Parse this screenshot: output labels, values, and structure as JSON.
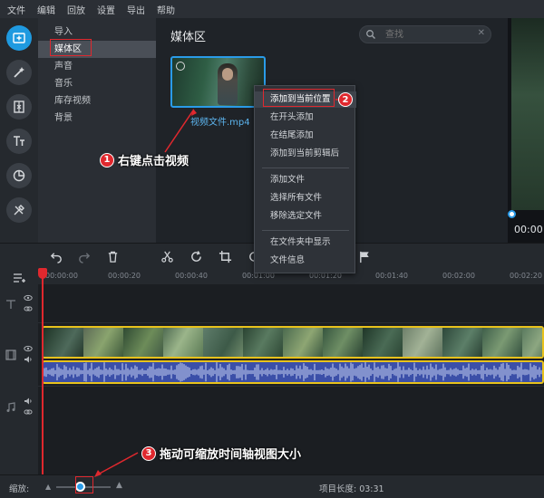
{
  "menu": [
    "文件",
    "编辑",
    "回放",
    "设置",
    "导出",
    "帮助"
  ],
  "sidebar": {
    "tools": [
      "add-media-icon",
      "magic-wand-icon",
      "transition-icon",
      "titles-icon",
      "stickers-icon",
      "tools-icon"
    ],
    "categories": [
      "导入",
      "媒体区",
      "声音",
      "音乐",
      "库存视频",
      "背景"
    ],
    "selected": "媒体区"
  },
  "media": {
    "title": "媒体区",
    "search_placeholder": "查找",
    "clip_name": "视频文件.mp4"
  },
  "context_menu": {
    "group1": [
      "添加到当前位置",
      "在开头添加",
      "在结尾添加",
      "添加到当前剪辑后"
    ],
    "group2": [
      "添加文件",
      "选择所有文件",
      "移除选定文件"
    ],
    "group3": [
      "在文件夹中显示",
      "文件信息"
    ],
    "highlighted": "添加到当前位置"
  },
  "preview": {
    "time": "00:00"
  },
  "ruler": [
    "00:00:00",
    "00:00:20",
    "00:00:40",
    "00:01:00",
    "00:01:20",
    "00:01:40",
    "00:02:00",
    "00:02:20"
  ],
  "bottom": {
    "zoom_label": "缩放:",
    "project_length": "项目长度: 03:31",
    "zoom_level": 0.45
  },
  "annotations": {
    "a1": "右键点击视频",
    "a2": "",
    "a3": "拖动可缩放时间轴视图大小",
    "n1": "1",
    "n2": "2",
    "n3": "3"
  },
  "colors": {
    "accent": "#2a9be8",
    "annotation": "#e0282e",
    "clip_border": "#e8c21c",
    "audio": "#3b4fa8"
  }
}
